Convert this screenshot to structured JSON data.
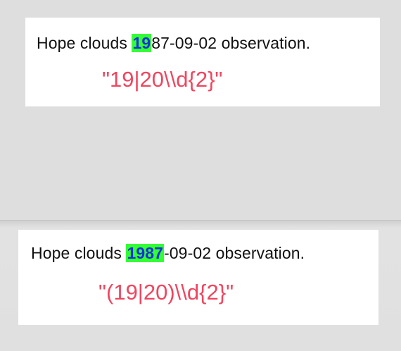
{
  "top_panel": {
    "sentence_before": "Hope clouds ",
    "match": "19",
    "sentence_after": "87-09-02 observation.",
    "regex": "\"19|20\\\\d{2}\""
  },
  "bottom_panel": {
    "sentence_before": "Hope clouds ",
    "match": "1987",
    "sentence_after": "-09-02 observation.",
    "regex": "\"(19|20)\\\\d{2}\""
  },
  "colors": {
    "highlight_bg": "#33ff33",
    "highlight_text": "#1a2fe0",
    "regex_text": "#f0455f"
  }
}
